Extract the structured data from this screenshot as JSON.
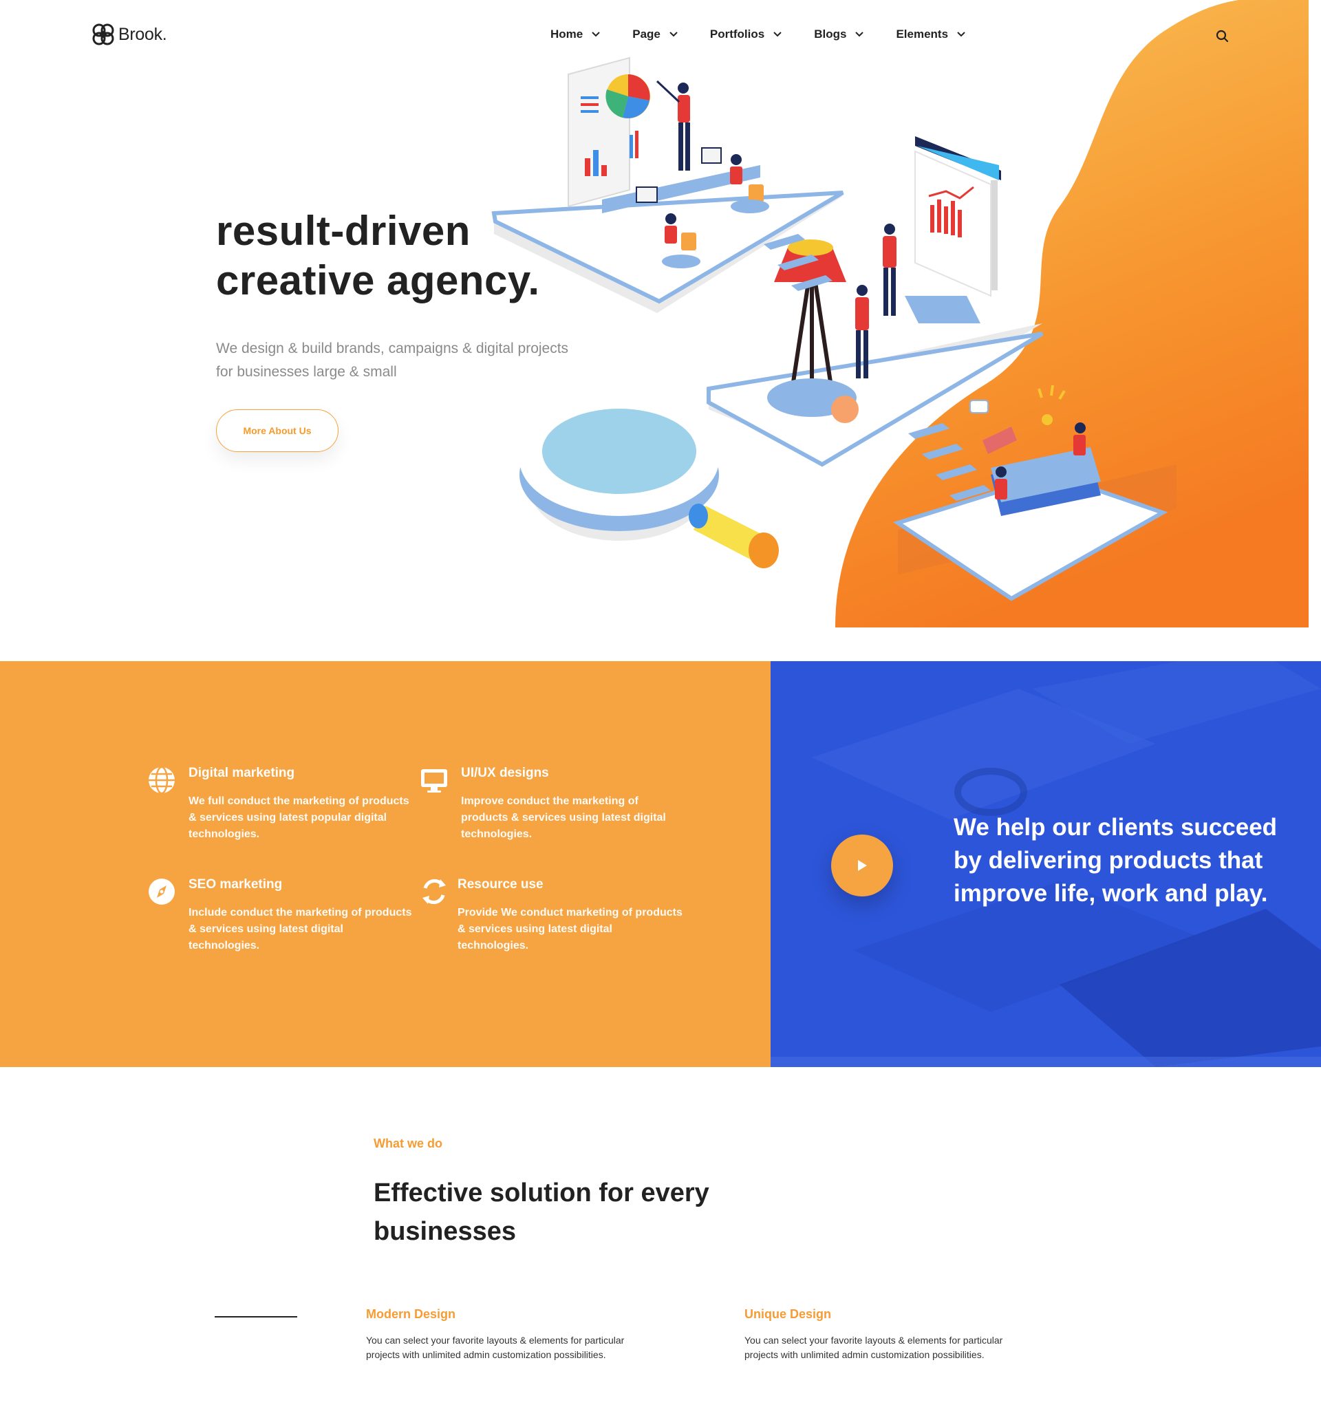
{
  "brand": {
    "name": "Brook."
  },
  "nav": {
    "items": [
      {
        "label": "Home"
      },
      {
        "label": "Page"
      },
      {
        "label": "Portfolios"
      },
      {
        "label": "Blogs"
      },
      {
        "label": "Elements"
      }
    ],
    "search_icon": "search-icon"
  },
  "hero": {
    "title_line1": "result-driven",
    "title_line2": "creative agency.",
    "subtitle": "We design & build brands, campaigns & digital projects for businesses large & small",
    "button_label": "More About Us"
  },
  "features": [
    {
      "icon": "globe-icon",
      "title": "Digital marketing",
      "desc": "We full conduct the marketing of products & services using latest popular digital technologies."
    },
    {
      "icon": "monitor-icon",
      "title": "UI/UX designs",
      "desc": "Improve conduct the marketing of products & services using latest digital technologies."
    },
    {
      "icon": "compass-icon",
      "title": "SEO marketing",
      "desc": "Include conduct the marketing of products & services using latest digital technologies."
    },
    {
      "icon": "recycle-icon",
      "title": "Resource use",
      "desc": "Provide We conduct marketing of products & services using latest digital technologies."
    }
  ],
  "video_block": {
    "text": "We help our clients succeed by delivering products that improve life, work and play."
  },
  "what_we_do": {
    "eyebrow": "What we do",
    "title": "Effective solution for every businesses",
    "cards": [
      {
        "title": "Modern Design",
        "desc": "You can select your favorite layouts & elements for particular projects with unlimited admin customization possibilities."
      },
      {
        "title": "Unique Design",
        "desc": "You can select your favorite layouts & elements for particular projects with unlimited admin customization possibilities."
      }
    ]
  },
  "colors": {
    "accent_orange": "#f6a341",
    "accent_blue": "#2d55d9",
    "text_dark": "#222222",
    "text_muted": "#8a8a8a"
  }
}
